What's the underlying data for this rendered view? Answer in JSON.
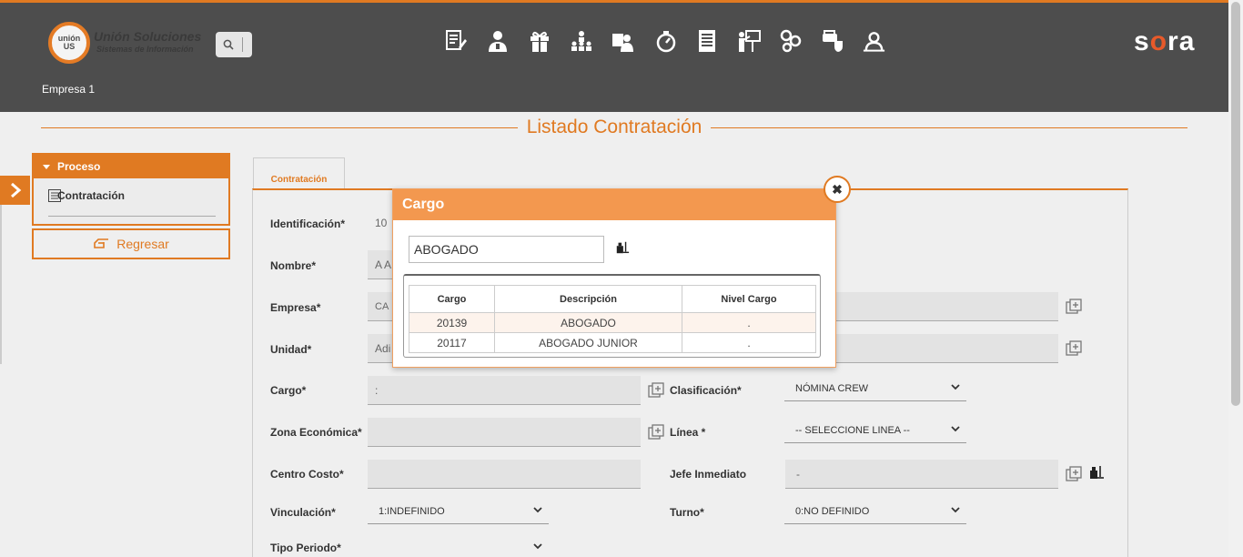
{
  "header": {
    "logo_mark": "unión US",
    "logo_line1": "Unión Soluciones",
    "logo_line2": "Sistemas de Información",
    "brand": "sora",
    "company": "Empresa 1",
    "toolbar_icons": [
      "edit-doc-icon",
      "user-icon",
      "gift-icon",
      "hierarchy-icon",
      "user-id-icon",
      "stopwatch-icon",
      "document-icon",
      "presentation-icon",
      "network-icon",
      "car-shield-icon",
      "team-icon"
    ]
  },
  "page_title": "Listado Contratación",
  "sidebar": {
    "section_title": "Proceso",
    "item_label": "Contratación",
    "back_label": "Regresar"
  },
  "tabs": [
    {
      "label": "Contratación"
    }
  ],
  "form": {
    "identificacion": {
      "label": "Identificación*",
      "value": "10"
    },
    "nombre": {
      "label": "Nombre*",
      "value": "A A"
    },
    "empresa": {
      "label": "Empresa*",
      "value": "CA"
    },
    "unidad": {
      "label": "Unidad*",
      "value": "Adi"
    },
    "cargo": {
      "label": "Cargo*",
      "value": ":"
    },
    "clasificacion": {
      "label": "Clasificación*",
      "value": "NÓMINA CREW"
    },
    "zona": {
      "label": "Zona Económica*",
      "value": ""
    },
    "linea": {
      "label": "Línea *",
      "value": "-- SELECCIONE LINEA --"
    },
    "centro": {
      "label": "Centro Costo*",
      "value": ""
    },
    "jefe": {
      "label": "Jefe Inmediato",
      "value": "-"
    },
    "vinculacion": {
      "label": "Vinculación*",
      "value": "1:INDEFINIDO"
    },
    "turno": {
      "label": "Turno*",
      "value": "0:NO DEFINIDO"
    },
    "tipo_periodo": {
      "label": "Tipo Periodo*",
      "value": ""
    }
  },
  "modal": {
    "title": "Cargo",
    "search_value": "ABOGADO",
    "columns": [
      "Cargo",
      "Descripción",
      "Nivel Cargo"
    ],
    "rows": [
      {
        "cargo": "20139",
        "descripcion": "ABOGADO",
        "nivel": "."
      },
      {
        "cargo": "20117",
        "descripcion": "ABOGADO JUNIOR",
        "nivel": "."
      }
    ]
  },
  "colors": {
    "accent": "#e07a22",
    "header_bg": "#4d4d4d",
    "modal_header": "#f3984f"
  }
}
